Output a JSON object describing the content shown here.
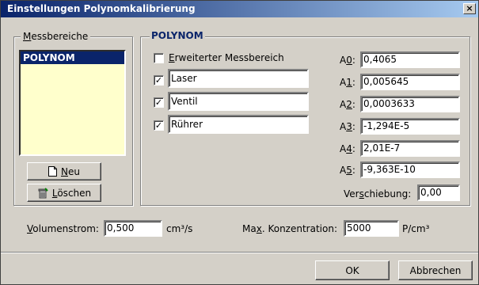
{
  "window": {
    "title": "Einstellungen Polynomkalibrierung",
    "close_label": "×"
  },
  "messbereiche": {
    "legend": "Messbereiche",
    "items": [
      "POLYNOM"
    ],
    "new_button": "Neu",
    "delete_button": "Löschen"
  },
  "polynom": {
    "legend": "POLYNOM",
    "extended_range": {
      "label": "Erweiterter Messbereich",
      "checked": false
    },
    "channels": [
      {
        "checked": true,
        "value": "Laser"
      },
      {
        "checked": true,
        "value": "Ventil"
      },
      {
        "checked": true,
        "value": "Rührer"
      }
    ],
    "coefficients": [
      {
        "label": "A0:",
        "value": "0,4065"
      },
      {
        "label": "A1:",
        "value": "0,005645"
      },
      {
        "label": "A2:",
        "value": "0,0003633"
      },
      {
        "label": "A3:",
        "value": "-1,294E-5"
      },
      {
        "label": "A4:",
        "value": "2,01E-7"
      },
      {
        "label": "A5:",
        "value": "-9,363E-10"
      }
    ],
    "shift": {
      "label": "Verschiebung:",
      "value": "0,00"
    }
  },
  "flow": {
    "label": "Volumenstrom:",
    "value": "0,500",
    "unit": "cm³/s"
  },
  "max_conc": {
    "label": "Max. Konzentration:",
    "value": "5000",
    "unit": "P/cm³"
  },
  "footer": {
    "ok": "OK",
    "cancel": "Abbrechen"
  }
}
